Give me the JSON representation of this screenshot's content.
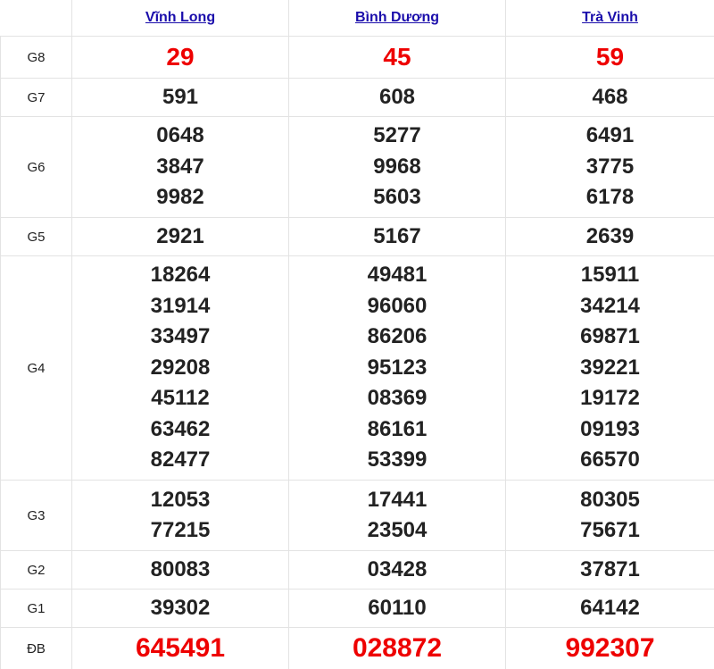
{
  "provinces": [
    "Vĩnh Long",
    "Bình Dương",
    "Trà Vinh"
  ],
  "prizes": [
    {
      "label": "G8",
      "numbers": [
        [
          "29"
        ],
        [
          "45"
        ],
        [
          "59"
        ]
      ]
    },
    {
      "label": "G7",
      "numbers": [
        [
          "591"
        ],
        [
          "608"
        ],
        [
          "468"
        ]
      ]
    },
    {
      "label": "G6",
      "numbers": [
        [
          "0648",
          "3847",
          "9982"
        ],
        [
          "5277",
          "9968",
          "5603"
        ],
        [
          "6491",
          "3775",
          "6178"
        ]
      ]
    },
    {
      "label": "G5",
      "numbers": [
        [
          "2921"
        ],
        [
          "5167"
        ],
        [
          "2639"
        ]
      ]
    },
    {
      "label": "G4",
      "numbers": [
        [
          "18264",
          "31914",
          "33497",
          "29208",
          "45112",
          "63462",
          "82477"
        ],
        [
          "49481",
          "96060",
          "86206",
          "95123",
          "08369",
          "86161",
          "53399"
        ],
        [
          "15911",
          "34214",
          "69871",
          "39221",
          "19172",
          "09193",
          "66570"
        ]
      ]
    },
    {
      "label": "G3",
      "numbers": [
        [
          "12053",
          "77215"
        ],
        [
          "17441",
          "23504"
        ],
        [
          "80305",
          "75671"
        ]
      ]
    },
    {
      "label": "G2",
      "numbers": [
        [
          "80083"
        ],
        [
          "03428"
        ],
        [
          "37871"
        ]
      ]
    },
    {
      "label": "G1",
      "numbers": [
        [
          "39302"
        ],
        [
          "60110"
        ],
        [
          "64142"
        ]
      ]
    },
    {
      "label": "ĐB",
      "numbers": [
        [
          "645491"
        ],
        [
          "028872"
        ],
        [
          "992307"
        ]
      ]
    }
  ],
  "colors": {
    "highlight": "#ee0000",
    "link": "#1a0dab",
    "text": "#222222",
    "border": "#e3e3e3"
  }
}
